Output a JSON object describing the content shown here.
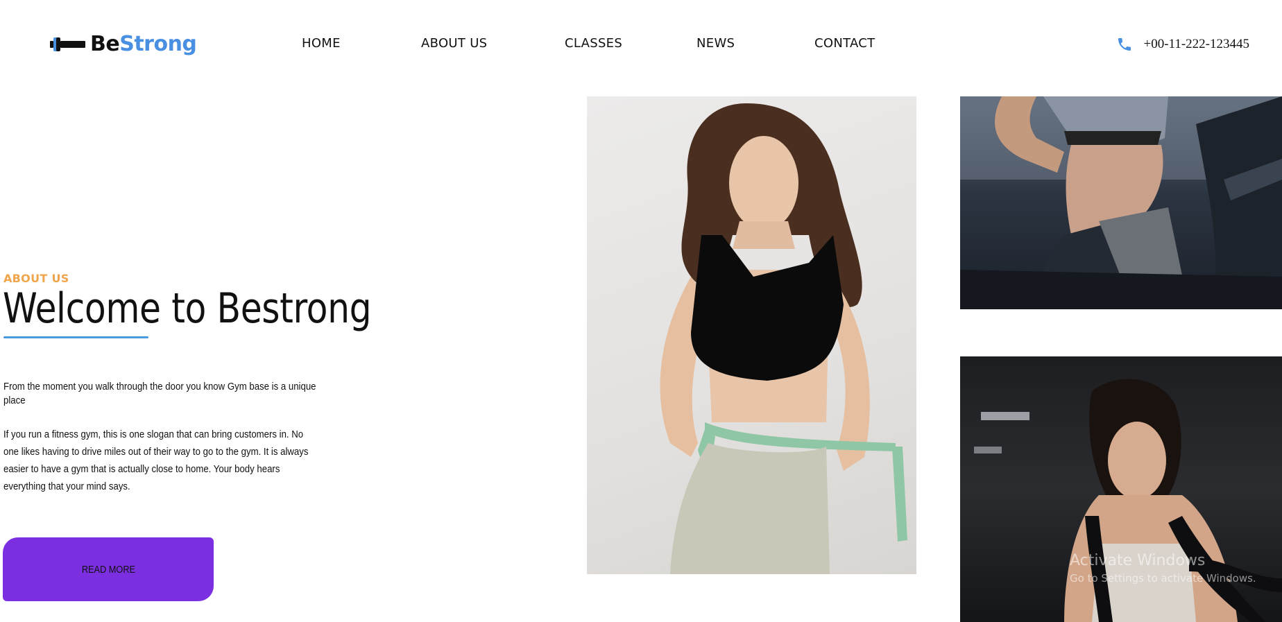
{
  "brand": {
    "part1": "Be",
    "part2": "Strong",
    "accent": "#4a90e2"
  },
  "nav": {
    "items": [
      {
        "label": "HOME"
      },
      {
        "label": "ABOUT US"
      },
      {
        "label": "CLASSES"
      },
      {
        "label": "NEWS"
      },
      {
        "label": "CONTACT"
      }
    ]
  },
  "contact": {
    "phone": "+00-11-222-123445",
    "icon": "phone-icon"
  },
  "hero": {
    "eyebrow": "ABOUT US",
    "title": "Welcome to Bestrong",
    "paragraph1": "From the moment you walk through the door you know Gym base is a unique place",
    "paragraph2": "If you run a fitness gym, this is one slogan that can bring customers in. No one likes having to drive miles out of their way to go to the gym. It is always easier to have a gym that is actually close to home. Your body hears everything that your mind says.",
    "button_label": "READ MORE",
    "eyebrow_color": "#f0a54a",
    "button_color": "#7b2fe0"
  },
  "watermark": {
    "line1": "Activate Windows",
    "line2": "Go to Settings to activate Windows."
  }
}
